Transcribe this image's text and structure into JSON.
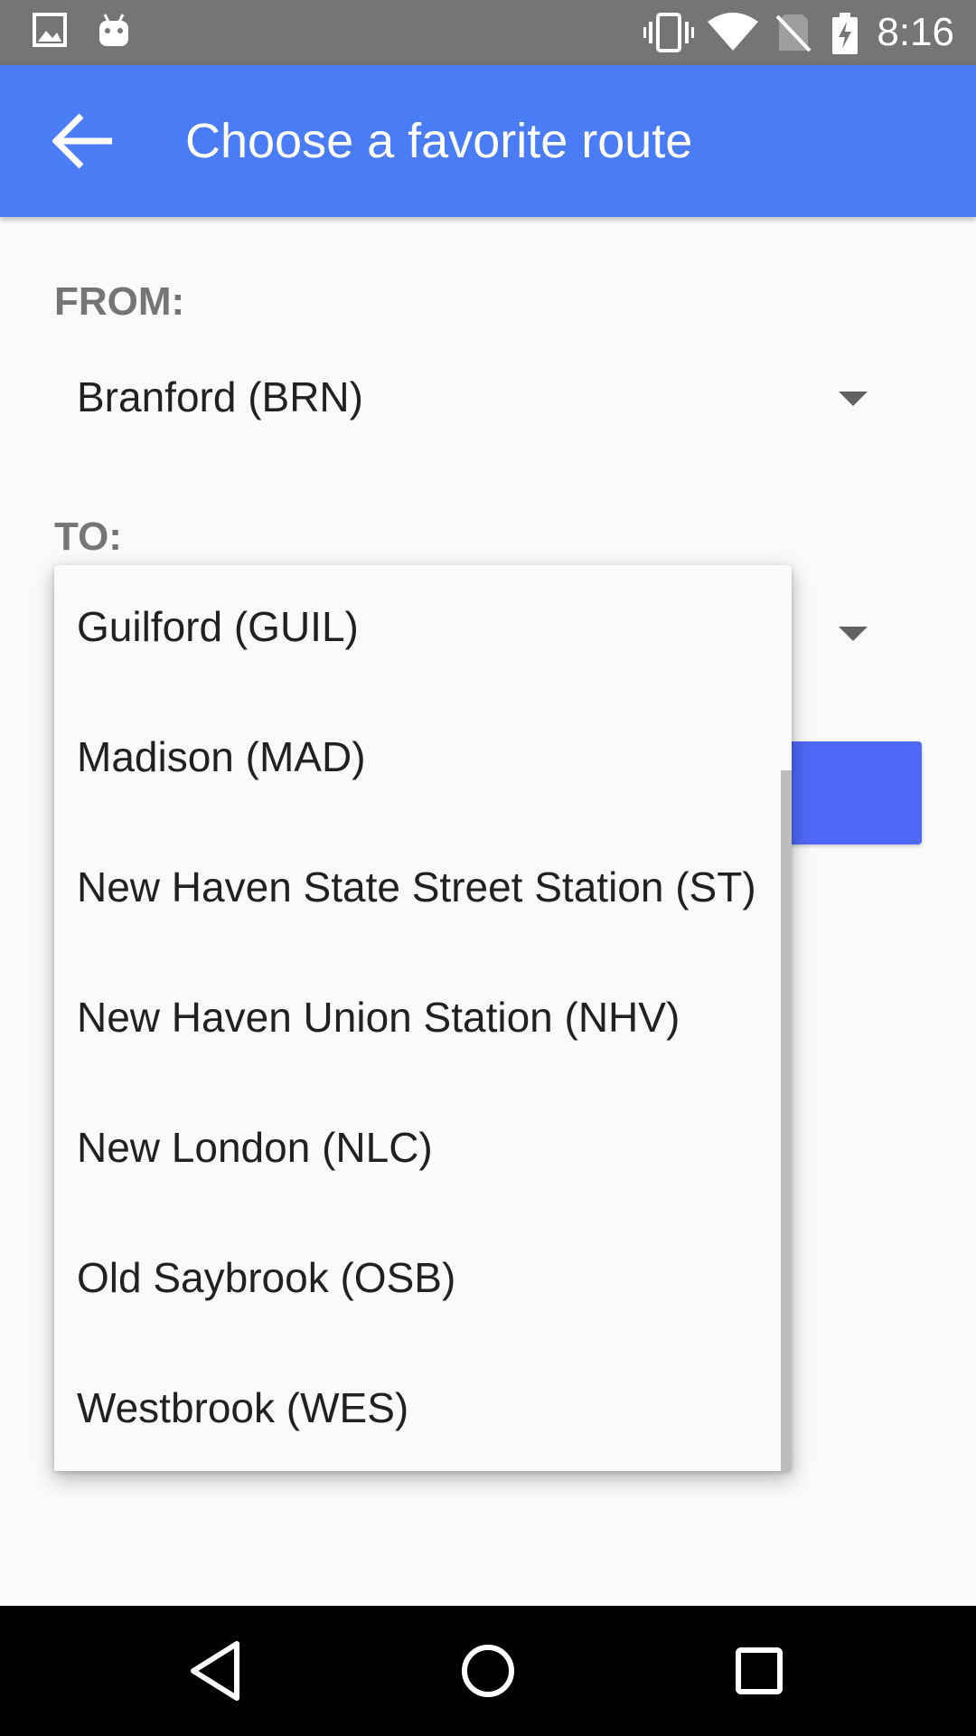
{
  "status_bar": {
    "time": "8:16",
    "left_icons": [
      "image-icon",
      "android-icon"
    ],
    "right_icons": [
      "vibrate-icon",
      "wifi-icon",
      "no-sim-icon",
      "battery-charging-icon"
    ]
  },
  "app_bar": {
    "title": "Choose a favorite route",
    "background": "#4a7cf6"
  },
  "form": {
    "from_label": "FROM:",
    "from_value": "Branford (BRN)",
    "to_label": "TO:"
  },
  "dropdown": {
    "options": [
      "Guilford (GUIL)",
      "Madison (MAD)",
      "New Haven State Street Station (ST)",
      "New Haven Union Station (NHV)",
      "New London (NLC)",
      "Old Saybrook (OSB)",
      "Westbrook (WES)"
    ]
  },
  "colors": {
    "accent": "#4a7cf6",
    "button": "#5068f7"
  }
}
